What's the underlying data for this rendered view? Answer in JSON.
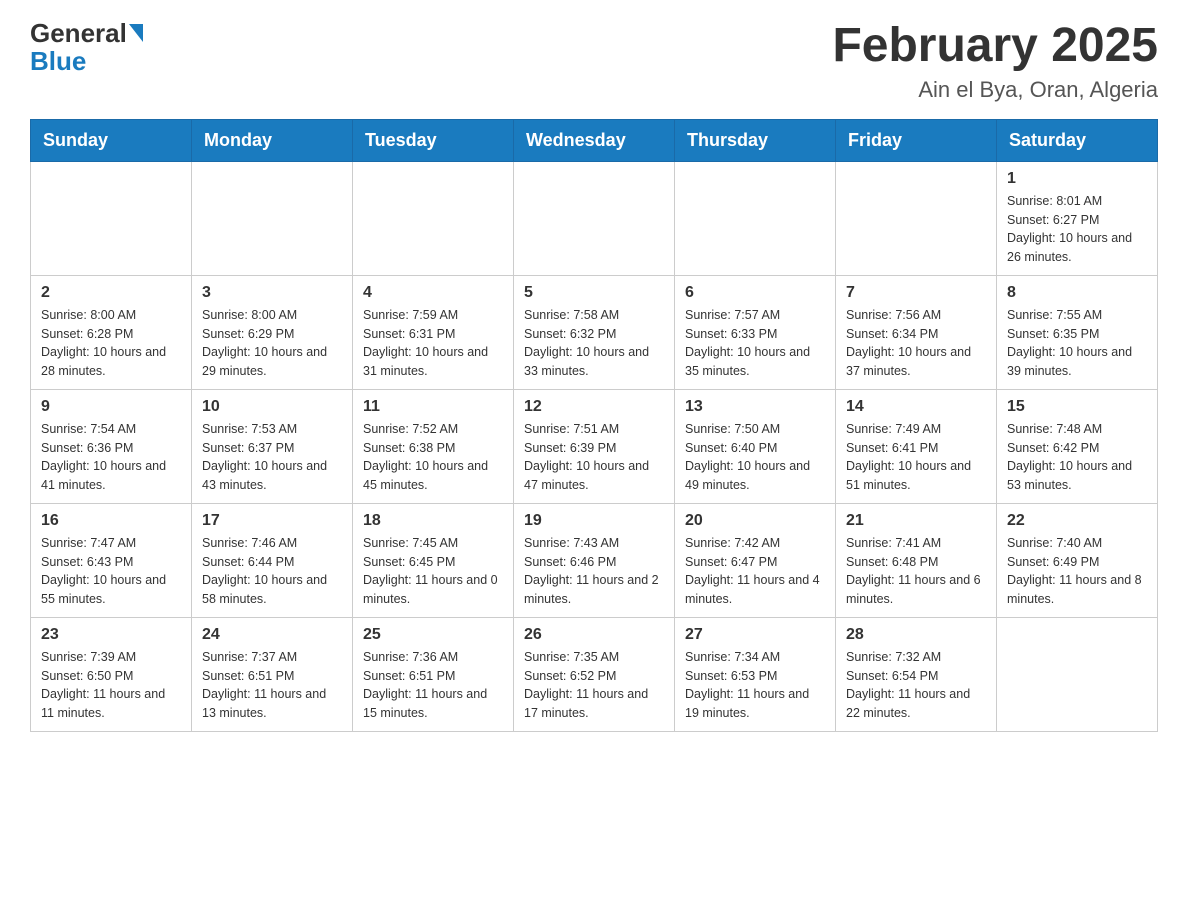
{
  "header": {
    "logo_general": "General",
    "logo_blue": "Blue",
    "title": "February 2025",
    "subtitle": "Ain el Bya, Oran, Algeria"
  },
  "weekdays": [
    "Sunday",
    "Monday",
    "Tuesday",
    "Wednesday",
    "Thursday",
    "Friday",
    "Saturday"
  ],
  "weeks": [
    [
      {
        "day": "",
        "sunrise": "",
        "sunset": "",
        "daylight": ""
      },
      {
        "day": "",
        "sunrise": "",
        "sunset": "",
        "daylight": ""
      },
      {
        "day": "",
        "sunrise": "",
        "sunset": "",
        "daylight": ""
      },
      {
        "day": "",
        "sunrise": "",
        "sunset": "",
        "daylight": ""
      },
      {
        "day": "",
        "sunrise": "",
        "sunset": "",
        "daylight": ""
      },
      {
        "day": "",
        "sunrise": "",
        "sunset": "",
        "daylight": ""
      },
      {
        "day": "1",
        "sunrise": "Sunrise: 8:01 AM",
        "sunset": "Sunset: 6:27 PM",
        "daylight": "Daylight: 10 hours and 26 minutes."
      }
    ],
    [
      {
        "day": "2",
        "sunrise": "Sunrise: 8:00 AM",
        "sunset": "Sunset: 6:28 PM",
        "daylight": "Daylight: 10 hours and 28 minutes."
      },
      {
        "day": "3",
        "sunrise": "Sunrise: 8:00 AM",
        "sunset": "Sunset: 6:29 PM",
        "daylight": "Daylight: 10 hours and 29 minutes."
      },
      {
        "day": "4",
        "sunrise": "Sunrise: 7:59 AM",
        "sunset": "Sunset: 6:31 PM",
        "daylight": "Daylight: 10 hours and 31 minutes."
      },
      {
        "day": "5",
        "sunrise": "Sunrise: 7:58 AM",
        "sunset": "Sunset: 6:32 PM",
        "daylight": "Daylight: 10 hours and 33 minutes."
      },
      {
        "day": "6",
        "sunrise": "Sunrise: 7:57 AM",
        "sunset": "Sunset: 6:33 PM",
        "daylight": "Daylight: 10 hours and 35 minutes."
      },
      {
        "day": "7",
        "sunrise": "Sunrise: 7:56 AM",
        "sunset": "Sunset: 6:34 PM",
        "daylight": "Daylight: 10 hours and 37 minutes."
      },
      {
        "day": "8",
        "sunrise": "Sunrise: 7:55 AM",
        "sunset": "Sunset: 6:35 PM",
        "daylight": "Daylight: 10 hours and 39 minutes."
      }
    ],
    [
      {
        "day": "9",
        "sunrise": "Sunrise: 7:54 AM",
        "sunset": "Sunset: 6:36 PM",
        "daylight": "Daylight: 10 hours and 41 minutes."
      },
      {
        "day": "10",
        "sunrise": "Sunrise: 7:53 AM",
        "sunset": "Sunset: 6:37 PM",
        "daylight": "Daylight: 10 hours and 43 minutes."
      },
      {
        "day": "11",
        "sunrise": "Sunrise: 7:52 AM",
        "sunset": "Sunset: 6:38 PM",
        "daylight": "Daylight: 10 hours and 45 minutes."
      },
      {
        "day": "12",
        "sunrise": "Sunrise: 7:51 AM",
        "sunset": "Sunset: 6:39 PM",
        "daylight": "Daylight: 10 hours and 47 minutes."
      },
      {
        "day": "13",
        "sunrise": "Sunrise: 7:50 AM",
        "sunset": "Sunset: 6:40 PM",
        "daylight": "Daylight: 10 hours and 49 minutes."
      },
      {
        "day": "14",
        "sunrise": "Sunrise: 7:49 AM",
        "sunset": "Sunset: 6:41 PM",
        "daylight": "Daylight: 10 hours and 51 minutes."
      },
      {
        "day": "15",
        "sunrise": "Sunrise: 7:48 AM",
        "sunset": "Sunset: 6:42 PM",
        "daylight": "Daylight: 10 hours and 53 minutes."
      }
    ],
    [
      {
        "day": "16",
        "sunrise": "Sunrise: 7:47 AM",
        "sunset": "Sunset: 6:43 PM",
        "daylight": "Daylight: 10 hours and 55 minutes."
      },
      {
        "day": "17",
        "sunrise": "Sunrise: 7:46 AM",
        "sunset": "Sunset: 6:44 PM",
        "daylight": "Daylight: 10 hours and 58 minutes."
      },
      {
        "day": "18",
        "sunrise": "Sunrise: 7:45 AM",
        "sunset": "Sunset: 6:45 PM",
        "daylight": "Daylight: 11 hours and 0 minutes."
      },
      {
        "day": "19",
        "sunrise": "Sunrise: 7:43 AM",
        "sunset": "Sunset: 6:46 PM",
        "daylight": "Daylight: 11 hours and 2 minutes."
      },
      {
        "day": "20",
        "sunrise": "Sunrise: 7:42 AM",
        "sunset": "Sunset: 6:47 PM",
        "daylight": "Daylight: 11 hours and 4 minutes."
      },
      {
        "day": "21",
        "sunrise": "Sunrise: 7:41 AM",
        "sunset": "Sunset: 6:48 PM",
        "daylight": "Daylight: 11 hours and 6 minutes."
      },
      {
        "day": "22",
        "sunrise": "Sunrise: 7:40 AM",
        "sunset": "Sunset: 6:49 PM",
        "daylight": "Daylight: 11 hours and 8 minutes."
      }
    ],
    [
      {
        "day": "23",
        "sunrise": "Sunrise: 7:39 AM",
        "sunset": "Sunset: 6:50 PM",
        "daylight": "Daylight: 11 hours and 11 minutes."
      },
      {
        "day": "24",
        "sunrise": "Sunrise: 7:37 AM",
        "sunset": "Sunset: 6:51 PM",
        "daylight": "Daylight: 11 hours and 13 minutes."
      },
      {
        "day": "25",
        "sunrise": "Sunrise: 7:36 AM",
        "sunset": "Sunset: 6:51 PM",
        "daylight": "Daylight: 11 hours and 15 minutes."
      },
      {
        "day": "26",
        "sunrise": "Sunrise: 7:35 AM",
        "sunset": "Sunset: 6:52 PM",
        "daylight": "Daylight: 11 hours and 17 minutes."
      },
      {
        "day": "27",
        "sunrise": "Sunrise: 7:34 AM",
        "sunset": "Sunset: 6:53 PM",
        "daylight": "Daylight: 11 hours and 19 minutes."
      },
      {
        "day": "28",
        "sunrise": "Sunrise: 7:32 AM",
        "sunset": "Sunset: 6:54 PM",
        "daylight": "Daylight: 11 hours and 22 minutes."
      },
      {
        "day": "",
        "sunrise": "",
        "sunset": "",
        "daylight": ""
      }
    ]
  ]
}
